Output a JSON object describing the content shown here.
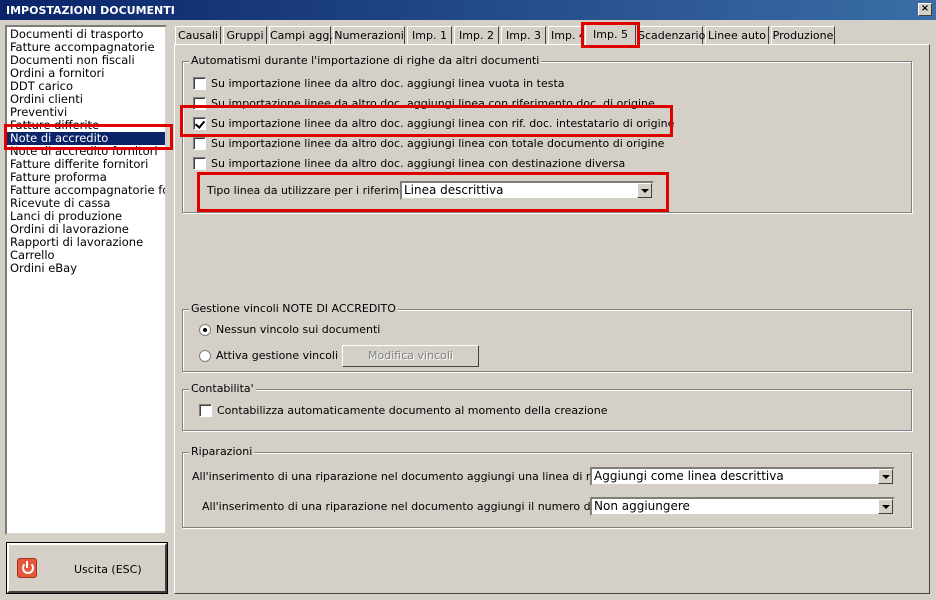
{
  "window": {
    "title": "IMPOSTAZIONI DOCUMENTI",
    "close_label": "×"
  },
  "sidebar": {
    "items": [
      {
        "label": "Documenti di trasporto"
      },
      {
        "label": "Fatture accompagnatorie"
      },
      {
        "label": "Documenti non fiscali"
      },
      {
        "label": "Ordini a fornitori"
      },
      {
        "label": "DDT carico"
      },
      {
        "label": "Ordini clienti"
      },
      {
        "label": "Preventivi"
      },
      {
        "label": "Fatture differite"
      },
      {
        "label": "Note di accredito"
      },
      {
        "label": "Note di accredito fornitori"
      },
      {
        "label": "Fatture differite fornitori"
      },
      {
        "label": "Fatture proforma"
      },
      {
        "label": "Fatture accompagnatorie fo"
      },
      {
        "label": "Ricevute di cassa"
      },
      {
        "label": "Lanci di produzione"
      },
      {
        "label": "Ordini di lavorazione"
      },
      {
        "label": "Rapporti di lavorazione"
      },
      {
        "label": "Carrello"
      },
      {
        "label": "Ordini eBay"
      }
    ],
    "selected": "Note di accredito"
  },
  "exit_button": {
    "label": "Uscita (ESC)"
  },
  "tabs": [
    {
      "label": "Causali"
    },
    {
      "label": "Gruppi"
    },
    {
      "label": "Campi agg."
    },
    {
      "label": "Numerazioni"
    },
    {
      "label": "Imp. 1"
    },
    {
      "label": "Imp. 2"
    },
    {
      "label": "Imp. 3"
    },
    {
      "label": "Imp. 4"
    },
    {
      "label": "Imp. 5"
    },
    {
      "label": "Scadenzario"
    },
    {
      "label": "Linee auto"
    },
    {
      "label": "Produzione"
    }
  ],
  "active_tab": "Imp. 5",
  "import_group": {
    "title": "Automatismi durante l'importazione di righe da altri documenti",
    "options": [
      {
        "label": "Su importazione linee da altro doc. aggiungi linea vuota in testa",
        "checked": false
      },
      {
        "label": "Su importazione linee da altro doc. aggiungi linea con riferimento doc. di origine",
        "checked": false
      },
      {
        "label": "Su importazione linee da altro doc. aggiungi linea con rif. doc. intestatario di origine",
        "checked": true
      },
      {
        "label": "Su importazione linee da altro doc. aggiungi linea con totale documento di origine",
        "checked": false
      },
      {
        "label": "Su importazione linee da altro doc. aggiungi linea con destinazione diversa",
        "checked": false
      }
    ],
    "line_type_label": "Tipo linea da utilizzare per i riferimenti :",
    "line_type_value": "Linea descrittiva"
  },
  "links_group": {
    "title": "Gestione vincoli NOTE DI ACCREDITO",
    "radio_none": "Nessun vincolo sui documenti",
    "radio_active": "Attiva gestione vincoli",
    "selected": "none",
    "edit_button": "Modifica vincoli"
  },
  "accounting_group": {
    "title": "Contabilita'",
    "option": "Contabilizza automaticamente documento al momento della creazione",
    "checked": false
  },
  "repairs_group": {
    "title": "Riparazioni",
    "line_label": "All'inserimento di una riparazione nel documento aggiungi una linea di riferimento :",
    "line_value": "Aggiungi come linea descrittiva",
    "serial_label": "All'inserimento di una riparazione nel documento aggiungi il numero di matricola :",
    "serial_value": "Non aggiungere"
  }
}
